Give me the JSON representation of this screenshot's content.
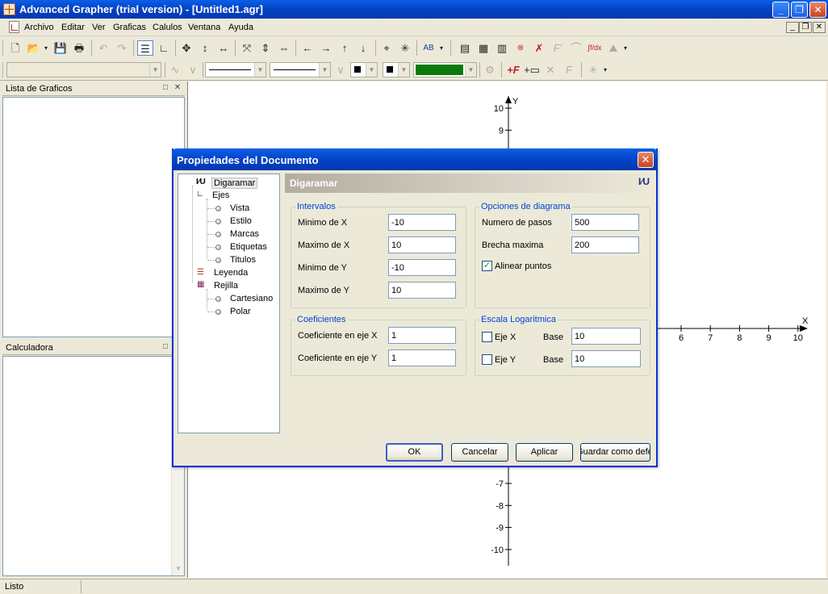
{
  "window": {
    "title": "Advanced Grapher (trial version) - [Untitled1.agr]",
    "minimize": "_",
    "restore": "❐",
    "close": "✕"
  },
  "menubar": {
    "items": [
      "Archivo",
      "Editar",
      "Ver",
      "Graficas",
      "Calulos",
      "Ventana",
      "Ayuda"
    ],
    "mdi_minimize": "_",
    "mdi_restore": "❐",
    "mdi_close": "✕"
  },
  "toolbar1": {
    "ab_label": "AB",
    "fdx_label": "∫f/dx",
    "fprime_label": "F'"
  },
  "panels": {
    "graph_list": {
      "title": "Lista de Graficos",
      "pin": "□",
      "close": "✕"
    },
    "calculator": {
      "title": "Calculadora",
      "pin": "□"
    }
  },
  "status": {
    "text": "Listo"
  },
  "graph": {
    "x_axis_label": "X",
    "y_axis_label": "Y",
    "x_ticks_visible": [
      "6",
      "7",
      "8",
      "9",
      "10"
    ],
    "y_ticks_top": [
      "10",
      "9"
    ],
    "y_ticks_bottom": [
      "-7",
      "-8",
      "-9",
      "-10"
    ]
  },
  "dialog": {
    "title": "Propiedades del Documento",
    "close": "✕",
    "tree": {
      "diagram": "Digaramar",
      "axes": "Ejes",
      "axes_children": [
        "Vista",
        "Estilo",
        "Marcas",
        "Etiquetas",
        "Titulos"
      ],
      "legend": "Leyenda",
      "grid": "Rejilla",
      "grid_children": [
        "Cartesiano",
        "Polar"
      ]
    },
    "section_title": "Digaramar",
    "section_icon": "I⁄U",
    "intervals": {
      "legend": "Intervalos",
      "min_x_label": "Minimo de X",
      "min_x": "-10",
      "max_x_label": "Maximo de X",
      "max_x": "10",
      "min_y_label": "Minimo de Y",
      "min_y": "-10",
      "max_y_label": "Maximo de Y",
      "max_y": "10"
    },
    "diagram_options": {
      "legend": "Opciones de diagrama",
      "steps_label": "Numero de pasos",
      "steps": "500",
      "gap_label": "Brecha maxima",
      "gap": "200",
      "align_label": "Alinear puntos",
      "align_checked": true
    },
    "coefficients": {
      "legend": "Coeficientes",
      "x_label": "Coeficiente en eje X",
      "x": "1",
      "y_label": "Coeficiente en eje Y",
      "y": "1"
    },
    "log_scale": {
      "legend": "Escala Logaritmica",
      "x_axis_label": "Eje X",
      "x_base_label": "Base",
      "x_base": "10",
      "y_axis_label": "Eje Y",
      "y_base_label": "Base",
      "y_base": "10"
    },
    "buttons": {
      "ok": "OK",
      "cancel": "Cancelar",
      "apply": "Aplicar",
      "save_default": "Guardar como defecto"
    }
  },
  "colors": {
    "plot_bg": "#ffffff",
    "axis": "#000000",
    "line_color_sample": "#0a7a0a",
    "title_blue": "#0543c5",
    "group_legend": "#0046d5"
  }
}
